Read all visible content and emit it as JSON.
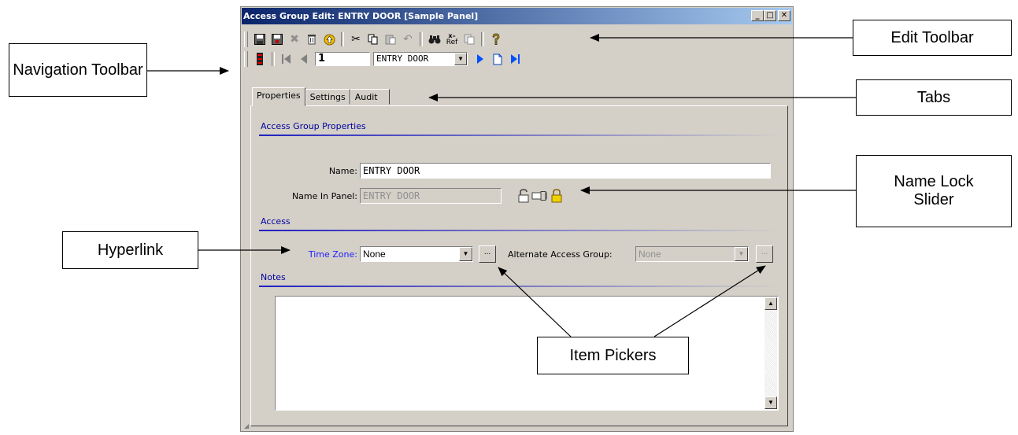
{
  "window": {
    "title": "Access Group Edit: ENTRY DOOR [Sample Panel]",
    "minimize_glyph": "_",
    "maximize_glyph": "□",
    "close_glyph": "✕"
  },
  "edit_toolbar": {
    "icons": [
      "save-icon",
      "save-all-icon",
      "cancel-icon",
      "delete-icon",
      "up-icon",
      "cut-icon",
      "copy-icon",
      "paste-icon",
      "undo-icon",
      "find-icon",
      "cross-ref-icon",
      "paste-special-icon",
      "help-icon"
    ],
    "glyphs": {
      "save": "💾",
      "save_all": "🖫",
      "cancel": "✖",
      "delete": "🗑",
      "up": "⊙",
      "cut": "✂",
      "copy": "⎘",
      "paste": "📋",
      "undo": "↶",
      "find": "🔍",
      "xref": "x–\nRef",
      "paste_special": "📄",
      "help": "?"
    }
  },
  "nav_toolbar": {
    "record_number": "1",
    "record_select": "ENTRY DOOR",
    "glyphs": {
      "list": "☰",
      "first": "|◀",
      "prev": "◀",
      "next": "▶",
      "new": "🗋",
      "last": "▶|"
    }
  },
  "tabs": [
    "Properties",
    "Settings",
    "Audit"
  ],
  "properties": {
    "section_title": "Access Group Properties",
    "name_label": "Name:",
    "name_value": "ENTRY DOOR",
    "name_in_panel_label": "Name In Panel:",
    "name_in_panel_value": "ENTRY DOOR",
    "lock_glyphs": {
      "unlocked": "🔓",
      "slider": "▭",
      "locked": "🔒"
    }
  },
  "access": {
    "section_title": "Access",
    "time_zone_label": "Time Zone:",
    "time_zone_value": "None",
    "picker_label": "...",
    "alternate_label": "Alternate Access Group:",
    "alternate_value": "None"
  },
  "notes": {
    "section_title": "Notes"
  },
  "callouts": {
    "navigation_toolbar": "Navigation Toolbar",
    "edit_toolbar": "Edit Toolbar",
    "tabs": "Tabs",
    "name_lock_slider": "Name Lock Slider",
    "hyperlink": "Hyperlink",
    "item_pickers": "Item Pickers"
  }
}
